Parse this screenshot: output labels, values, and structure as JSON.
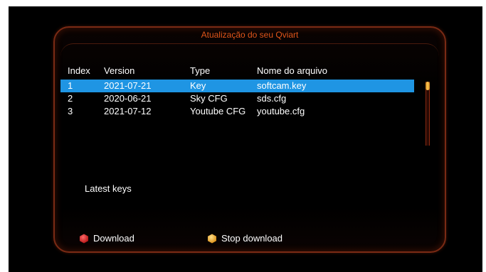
{
  "window": {
    "title": "Atualização do seu Qviart"
  },
  "table": {
    "headers": [
      "Index",
      "Version",
      "Type",
      "Nome do arquivo"
    ],
    "rows": [
      {
        "index": "1",
        "version": "2021-07-21",
        "type": "Key",
        "file": "softcam.key",
        "selected": true
      },
      {
        "index": "2",
        "version": "2020-06-21",
        "type": "Sky CFG",
        "file": "sds.cfg",
        "selected": false
      },
      {
        "index": "3",
        "version": "2021-07-12",
        "type": "Youtube CFG",
        "file": "youtube.cfg",
        "selected": false
      }
    ]
  },
  "description": "Latest keys",
  "footer": {
    "download_label": "Download",
    "stop_label": "Stop download"
  },
  "colors": {
    "accent_title": "#e0551a",
    "selection": "#1f95e3",
    "red_key": "#d42020",
    "yellow_key": "#f0b020"
  },
  "icons": {
    "download": "red-hexagon-key-icon",
    "stop": "yellow-hexagon-key-icon"
  }
}
